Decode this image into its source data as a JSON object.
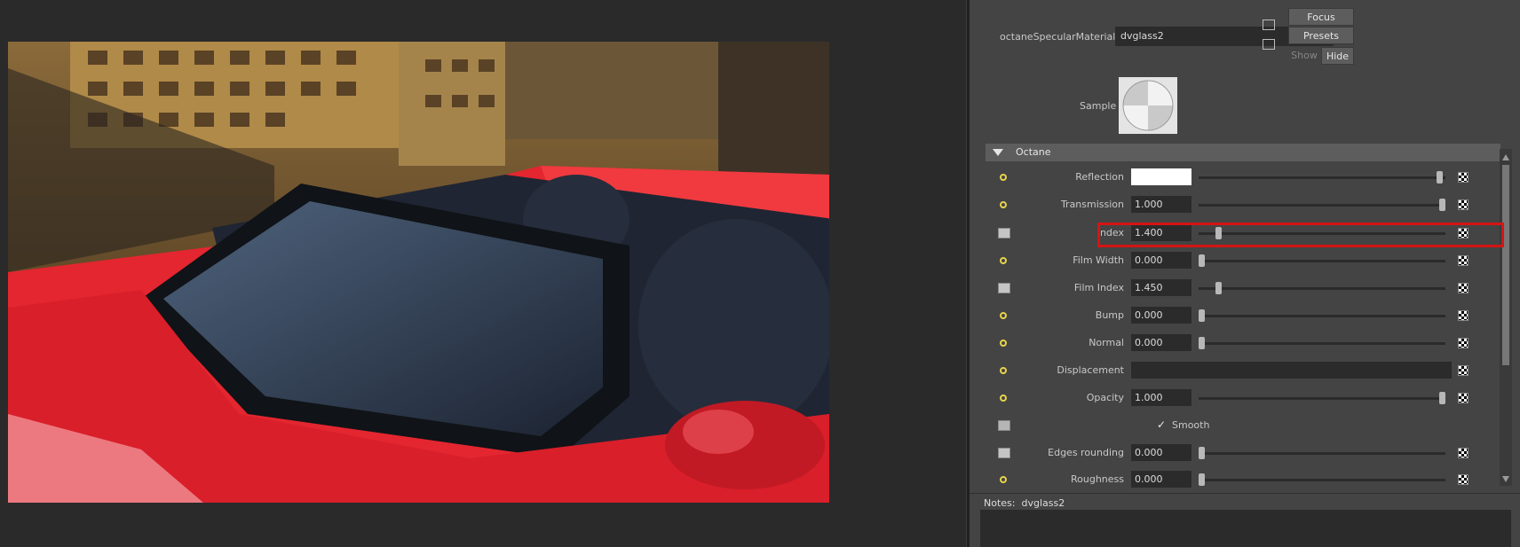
{
  "render": {
    "description_colors": {
      "car_body": "#e8232e",
      "interior": "#1c2230",
      "sky": "#c49b52"
    }
  },
  "material": {
    "type_label": "octaneSpecularMaterial:",
    "name": "dvglass2"
  },
  "buttons": {
    "focus": "Focus",
    "presets": "Presets",
    "show": "Show",
    "hide": "Hide"
  },
  "sample": {
    "label": "Sample"
  },
  "section": {
    "title": "Octane"
  },
  "attributes": [
    {
      "label": "Reflection",
      "value": "",
      "icon": "dot-icon",
      "slider": 0.99
    },
    {
      "label": "Transmission",
      "value": "1.000",
      "icon": "dot-icon",
      "slider": 1.0
    },
    {
      "label": "Index",
      "value": "1.400",
      "icon": "curve-icon",
      "slider": 0.07
    },
    {
      "label": "Film Width",
      "value": "0.000",
      "icon": "dot-icon",
      "slider": 0.0
    },
    {
      "label": "Film Index",
      "value": "1.450",
      "icon": "curve-icon",
      "slider": 0.07
    },
    {
      "label": "Bump",
      "value": "0.000",
      "icon": "dot-icon",
      "slider": 0.0
    },
    {
      "label": "Normal",
      "value": "0.000",
      "icon": "dot-icon",
      "slider": 0.0
    },
    {
      "label": "Displacement",
      "value": "",
      "icon": "dot-icon"
    },
    {
      "label": "Opacity",
      "value": "1.000",
      "icon": "dot-icon",
      "slider": 1.0
    },
    {
      "label": "Smooth",
      "checked": true,
      "icon": "stepper-icon"
    },
    {
      "label": "Edges rounding",
      "value": "0.000",
      "icon": "curve-icon",
      "slider": 0.0
    },
    {
      "label": "Roughness",
      "value": "0.000",
      "icon": "dot-icon",
      "slider": 0.0
    }
  ],
  "notes": {
    "label": "Notes:",
    "value": "dvglass2"
  },
  "colors": {
    "highlight": "#d51414",
    "reflection_swatch": "#ffffff",
    "panel": "#444444"
  }
}
